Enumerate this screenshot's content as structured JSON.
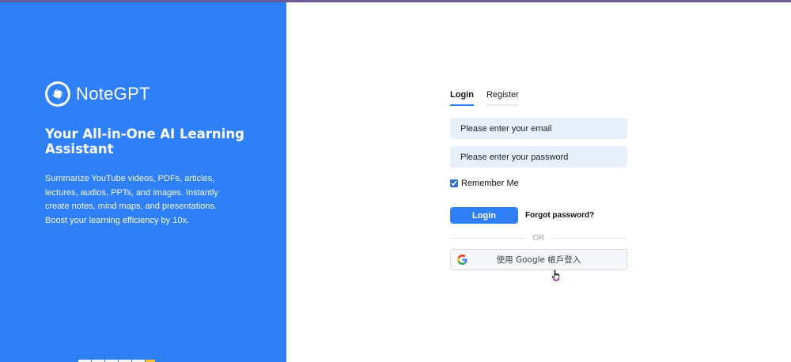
{
  "brand": {
    "name": "NoteGPT",
    "logo_icon": "swirl-logo-icon"
  },
  "hero": {
    "headline": "Your All-in-One AI Learning Assistant",
    "description": "Summarize YouTube videos, PDFs, articles, lectures, audios, PPTs, and images. Instantly create notes, mind maps, and presentations. Boost your learning efficiency by 10x."
  },
  "auth": {
    "tabs": [
      {
        "label": "Login",
        "active": true
      },
      {
        "label": "Register",
        "active": false
      }
    ],
    "email_placeholder": "Please enter your email",
    "password_placeholder": "Please enter your password",
    "remember_label": "Remember Me",
    "remember_checked": true,
    "login_label": "Login",
    "forgot_label": "Forgot password?",
    "divider_text": "OR",
    "google_label": "使用 Google 帳戶登入",
    "google_icon": "google-g-icon"
  },
  "colors": {
    "brand_blue": "#2f80f6",
    "input_bg": "#e8f0fd",
    "top_strip": "#6b5a9a"
  }
}
